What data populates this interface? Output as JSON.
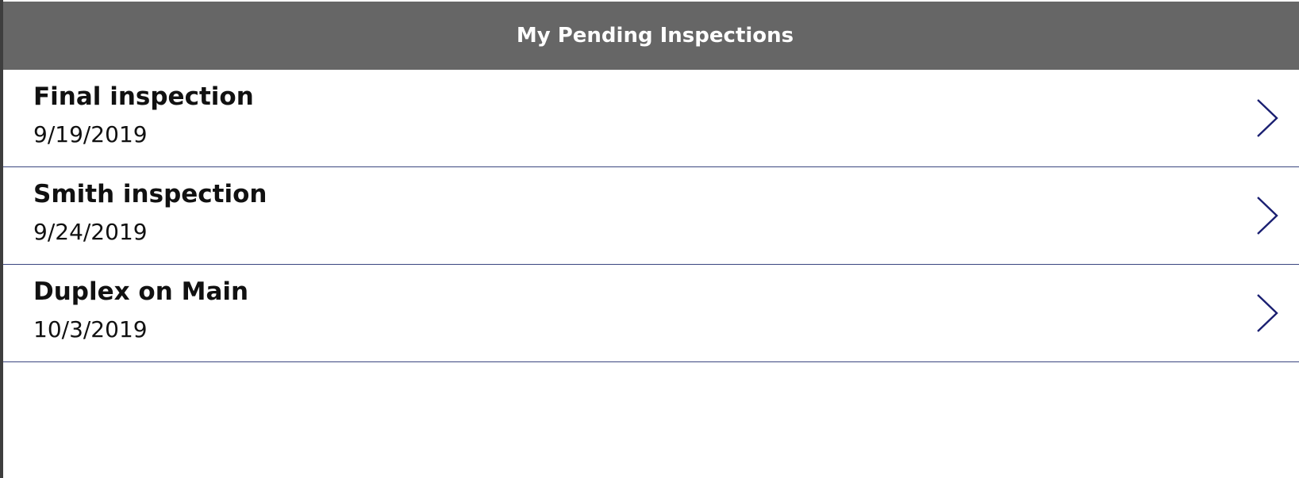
{
  "header": {
    "title": "My Pending Inspections"
  },
  "inspections": [
    {
      "title": "Final inspection",
      "date": "9/19/2019"
    },
    {
      "title": "Smith inspection",
      "date": "9/24/2019"
    },
    {
      "title": "Duplex on Main",
      "date": "10/3/2019"
    }
  ],
  "colors": {
    "header_bg": "#666666",
    "accent": "#1a1f71",
    "divider": "#3a4680"
  },
  "icons": {
    "row_action": "chevron-right-icon"
  }
}
